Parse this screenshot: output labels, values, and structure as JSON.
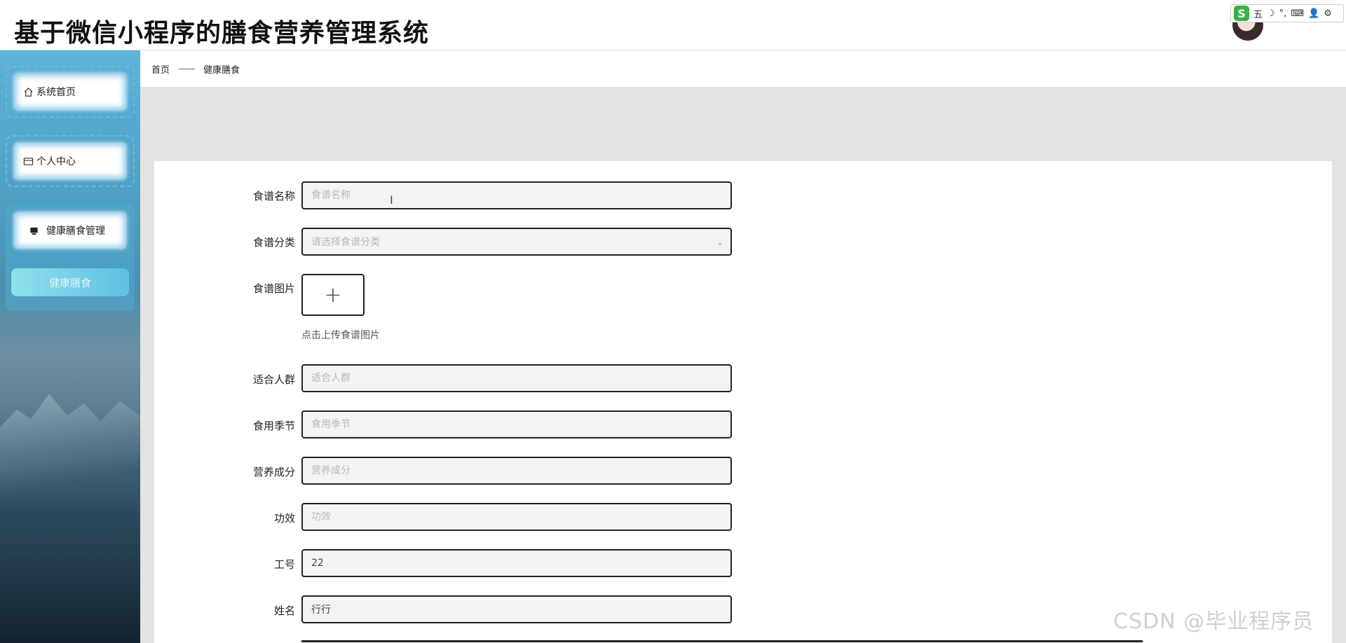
{
  "app": {
    "title": "基于微信小程序的膳食营养管理系统"
  },
  "ime": {
    "logo": "S",
    "glyphs": [
      "五",
      "☽",
      "°,",
      "⌨",
      "👤",
      "⚙"
    ]
  },
  "sidebar": {
    "items": [
      {
        "label": "系统首页",
        "icon": "home-icon"
      },
      {
        "label": "个人中心",
        "icon": "id-card-icon"
      },
      {
        "label": "健康膳食管理",
        "icon": "monitor-icon"
      }
    ],
    "submenu": {
      "label": "健康膳食"
    }
  },
  "breadcrumb": {
    "home": "首页",
    "separator": "——",
    "current": "健康膳食"
  },
  "form": {
    "recipe_name": {
      "label": "食谱名称",
      "placeholder": "食谱名称",
      "value": ""
    },
    "recipe_category": {
      "label": "食谱分类",
      "placeholder": "请选择食谱分类"
    },
    "recipe_image": {
      "label": "食谱图片",
      "hint": "点击上传食谱图片",
      "plus": "+"
    },
    "suitable_people": {
      "label": "适合人群",
      "placeholder": "适合人群",
      "value": ""
    },
    "season": {
      "label": "食用季节",
      "placeholder": "食用季节",
      "value": ""
    },
    "nutrition": {
      "label": "营养成分",
      "placeholder": "营养成分",
      "value": ""
    },
    "effect": {
      "label": "功效",
      "placeholder": "功效",
      "value": ""
    },
    "job_number": {
      "label": "工号",
      "placeholder": "",
      "value": "22"
    },
    "name": {
      "label": "姓名",
      "placeholder": "",
      "value": "行行"
    }
  },
  "watermark": "CSDN @毕业程序员",
  "colors": {
    "sidebar_top": "#5db3d8",
    "submenu_active": "#5fc0e6",
    "input_border": "#222222"
  }
}
